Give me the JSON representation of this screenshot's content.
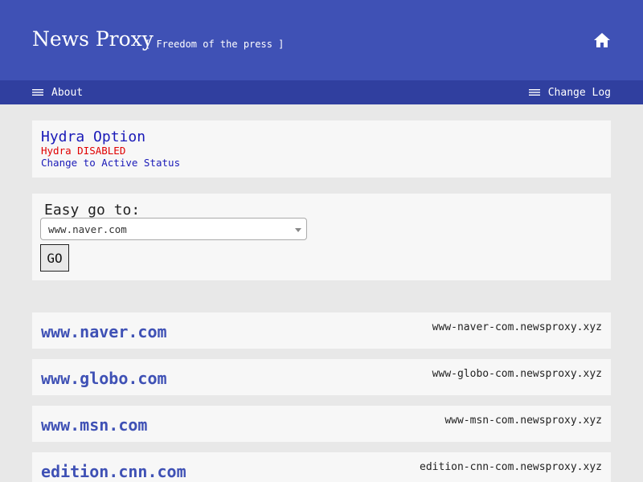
{
  "header": {
    "title": "News Proxy",
    "tagline": "[ Freedom of the press ]",
    "home_icon": "home-icon"
  },
  "nav": {
    "about": "About",
    "changelog": "Change Log",
    "menu_icon": "menu-icon"
  },
  "hydra": {
    "title": "Hydra Option",
    "status": "Hydra DISABLED",
    "link": "Change to Active Status"
  },
  "goto": {
    "label": "Easy go to:",
    "selected": "www.naver.com",
    "button": "GO"
  },
  "sites": [
    {
      "name": "www.naver.com",
      "proxy": "www-naver-com.newsproxy.xyz"
    },
    {
      "name": "www.globo.com",
      "proxy": "www-globo-com.newsproxy.xyz"
    },
    {
      "name": "www.msn.com",
      "proxy": "www-msn-com.newsproxy.xyz"
    },
    {
      "name": "edition.cnn.com",
      "proxy": "edition-cnn-com.newsproxy.xyz"
    }
  ],
  "colors": {
    "header_bg": "#3f51b5",
    "nav_bg": "#303f9f",
    "card_bg": "#f7f7f7",
    "page_bg": "#e8e8e8",
    "link_blue": "#3f51b5",
    "hydra_blue": "#1a1ab8",
    "status_red": "#e00000"
  }
}
